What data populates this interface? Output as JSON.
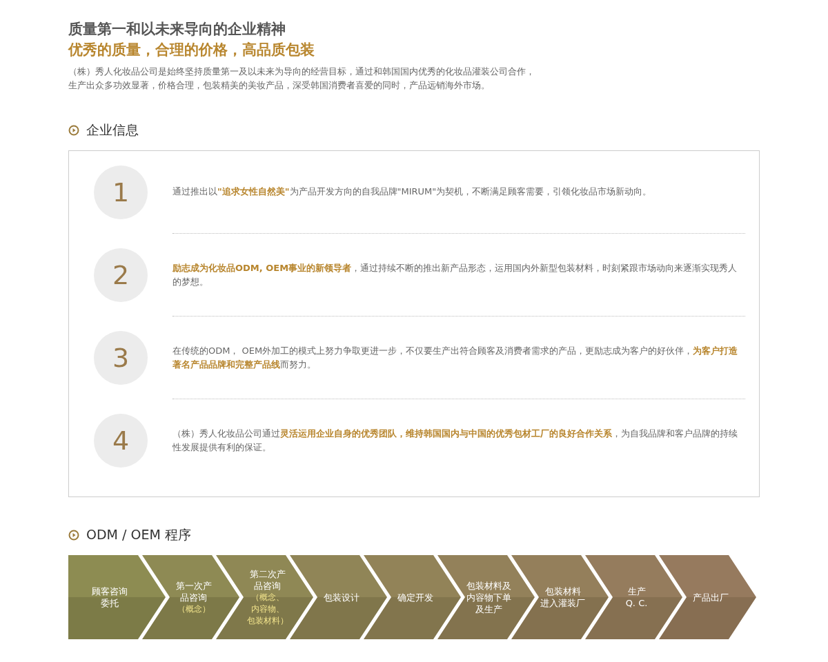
{
  "heading": {
    "title": "质量第一和以未来导向的企业精神",
    "subtitle": "优秀的质量，合理的价格，高品质包装",
    "intro": [
      "（株）秀人化妆品公司是始终坚持质量第一及以未来为导向的经营目标，通过和韩国国内优秀的化妆品灌装公司合作，",
      "生产出众多功效显著，价格合理，包装精美的美妆产品，深受韩国消费者喜爱的同时，产品远销海外市场。"
    ]
  },
  "company_info": {
    "title": "企业信息",
    "items": [
      {
        "number": "1",
        "text": "通过推出以**\"追求女性自然美\"**为产品开发方向的自我品牌\"MIRUM\"为契机，不断满足顾客需要，引领化妆品市场新动向。"
      },
      {
        "number": "2",
        "text": "**励志成为化妆品ODM, OEM事业的新领导者**，通过持续不断的推出新产品形态，运用国内外新型包装材料，时刻紧跟市场动向来逐渐实现秀人的梦想。"
      },
      {
        "number": "3",
        "text": "在传统的ODM， OEM外加工的模式上努力争取更进一步，不仅要生产出符合顾客及消费者需求的产品，更励志成为客户的好伙伴，**为客户打造著名产品品牌和完整产品线**而努力。"
      },
      {
        "number": "4",
        "text": "（株）秀人化妆品公司通过**灵活运用企业自身的优秀团队，维持韩国国内与中国的优秀包材工厂的良好合作关系**，为自我品牌和客户品牌的持续性发展提供有利的保证。"
      }
    ]
  },
  "process": {
    "title": "ODM / OEM 程序",
    "steps": [
      {
        "lines": [
          "顾客咨询",
          "委托"
        ]
      },
      {
        "lines": [
          "第一次产",
          "品咨询"
        ],
        "note": [
          "（概念）"
        ]
      },
      {
        "lines": [
          "第二次产",
          "品咨询"
        ],
        "note": [
          "（概念、",
          "内容物、",
          "包装材料）"
        ]
      },
      {
        "lines": [
          "包装设计"
        ]
      },
      {
        "lines": [
          "确定开发"
        ]
      },
      {
        "lines": [
          "包装材料及",
          "内容物下单",
          "及生产"
        ]
      },
      {
        "lines": [
          "包装材料",
          "进入灌装厂"
        ]
      },
      {
        "lines": [
          "生产",
          "Q. C."
        ]
      },
      {
        "lines": [
          "产品出厂"
        ]
      }
    ]
  }
}
